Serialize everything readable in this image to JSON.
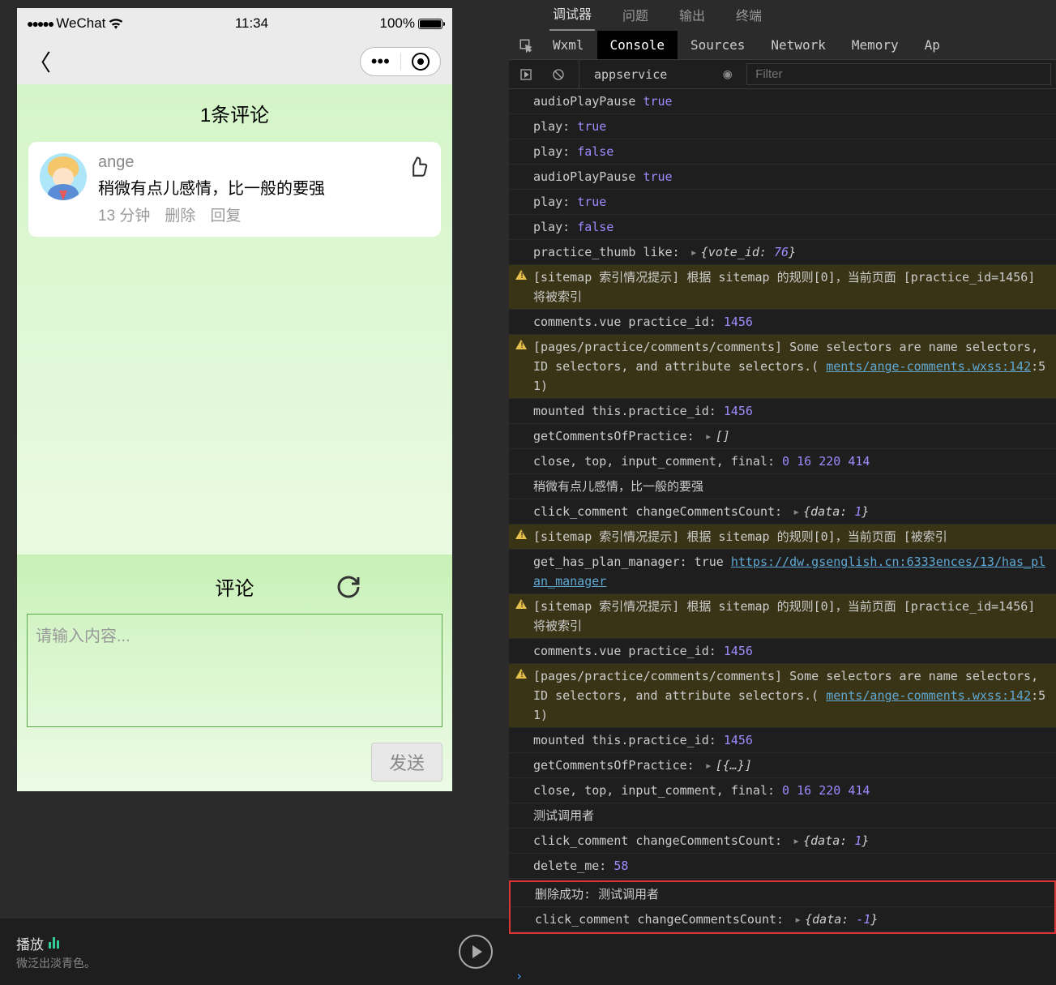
{
  "phone": {
    "statusbar": {
      "carrier": "WeChat",
      "signal_dots": "●●●●●",
      "time": "11:34",
      "battery_pct": "100%"
    },
    "page": {
      "title": "1条评论",
      "comment": {
        "user": "ange",
        "text": "稍微有点儿感情，比一般的要强",
        "time": "13 分钟",
        "delete_label": "删除",
        "reply_label": "回复"
      },
      "footer": {
        "title": "评论",
        "placeholder": "请输入内容...",
        "send_label": "发送"
      }
    }
  },
  "player": {
    "title": "播放",
    "subtitle": "微泛出淡青色。"
  },
  "devtools": {
    "topTabs": [
      "调试器",
      "问题",
      "输出",
      "终端"
    ],
    "topActive": 0,
    "panelTabs": [
      "Wxml",
      "Console",
      "Sources",
      "Network",
      "Memory",
      "Ap"
    ],
    "panelActive": 1,
    "context": "appservice",
    "filterPlaceholder": "Filter",
    "logs": [
      {
        "t": "log",
        "parts": [
          {
            "k": "key",
            "v": "audioPlayPause "
          },
          {
            "k": "bool",
            "v": "true"
          }
        ]
      },
      {
        "t": "log",
        "parts": [
          {
            "k": "key",
            "v": "play: "
          },
          {
            "k": "bool",
            "v": "true"
          }
        ]
      },
      {
        "t": "log",
        "parts": [
          {
            "k": "key",
            "v": "play: "
          },
          {
            "k": "bool",
            "v": "false"
          }
        ]
      },
      {
        "t": "log",
        "parts": [
          {
            "k": "key",
            "v": "audioPlayPause "
          },
          {
            "k": "bool",
            "v": "true"
          }
        ]
      },
      {
        "t": "log",
        "parts": [
          {
            "k": "key",
            "v": "play: "
          },
          {
            "k": "bool",
            "v": "true"
          }
        ]
      },
      {
        "t": "log",
        "parts": [
          {
            "k": "key",
            "v": "play: "
          },
          {
            "k": "bool",
            "v": "false"
          }
        ]
      },
      {
        "t": "log",
        "parts": [
          {
            "k": "key",
            "v": "practice_thumb like:  "
          },
          {
            "k": "caret"
          },
          {
            "k": "obj",
            "v": "{vote_id: 76}"
          }
        ]
      },
      {
        "t": "warn",
        "parts": [
          {
            "k": "txt",
            "v": "[sitemap 索引情况提示] 根据 sitemap 的规则[0]，当前页面 [practice_id=1456] 将被索引"
          }
        ]
      },
      {
        "t": "log",
        "parts": [
          {
            "k": "key",
            "v": "comments.vue practice_id:  "
          },
          {
            "k": "num",
            "v": "1456"
          }
        ]
      },
      {
        "t": "warn",
        "parts": [
          {
            "k": "txt",
            "v": "[pages/practice/comments/comments] Some selectors are name selectors, ID selectors, and attribute selectors.( "
          },
          {
            "k": "link",
            "v": "ments/ange-comments.wxss:142"
          },
          {
            "k": "txt",
            "v": ":51)"
          }
        ]
      },
      {
        "t": "log",
        "parts": [
          {
            "k": "key",
            "v": "mounted this.practice_id:  "
          },
          {
            "k": "num",
            "v": "1456"
          }
        ]
      },
      {
        "t": "log",
        "parts": [
          {
            "k": "key",
            "v": "getCommentsOfPractice:  "
          },
          {
            "k": "caret"
          },
          {
            "k": "obj",
            "v": "[]"
          }
        ]
      },
      {
        "t": "log",
        "parts": [
          {
            "k": "key",
            "v": "close, top, input_comment, final:  "
          },
          {
            "k": "num",
            "v": "0 16 220 414"
          }
        ]
      },
      {
        "t": "log",
        "parts": [
          {
            "k": "key",
            "v": "稍微有点儿感情，比一般的要强"
          }
        ]
      },
      {
        "t": "log",
        "parts": [
          {
            "k": "key",
            "v": "click_comment changeCommentsCount: "
          },
          {
            "k": "caret"
          },
          {
            "k": "obj",
            "v": "{data: 1}"
          }
        ]
      },
      {
        "t": "warn",
        "parts": [
          {
            "k": "txt",
            "v": "[sitemap 索引情况提示] 根据 sitemap 的规则[0]，当前页面 [被索引"
          }
        ]
      },
      {
        "t": "log",
        "parts": [
          {
            "k": "key",
            "v": "get_has_plan_manager: true "
          },
          {
            "k": "link",
            "v": "https://dw.gsenglish.cn:6333ences/13/has_plan_manager"
          }
        ]
      },
      {
        "t": "warn",
        "parts": [
          {
            "k": "txt",
            "v": "[sitemap 索引情况提示] 根据 sitemap 的规则[0]，当前页面 [practice_id=1456] 将被索引"
          }
        ]
      },
      {
        "t": "log",
        "parts": [
          {
            "k": "key",
            "v": "comments.vue practice_id:  "
          },
          {
            "k": "num",
            "v": "1456"
          }
        ]
      },
      {
        "t": "warn",
        "parts": [
          {
            "k": "txt",
            "v": "[pages/practice/comments/comments] Some selectors are name selectors, ID selectors, and attribute selectors.( "
          },
          {
            "k": "link",
            "v": "ments/ange-comments.wxss:142"
          },
          {
            "k": "txt",
            "v": ":51)"
          }
        ]
      },
      {
        "t": "log",
        "parts": [
          {
            "k": "key",
            "v": "mounted this.practice_id:  "
          },
          {
            "k": "num",
            "v": "1456"
          }
        ]
      },
      {
        "t": "log",
        "parts": [
          {
            "k": "key",
            "v": "getCommentsOfPractice:  "
          },
          {
            "k": "caret"
          },
          {
            "k": "obj",
            "v": "[{…}]"
          }
        ]
      },
      {
        "t": "log",
        "parts": [
          {
            "k": "key",
            "v": "close, top, input_comment, final:  "
          },
          {
            "k": "num",
            "v": "0 16 220 414"
          }
        ]
      },
      {
        "t": "log",
        "parts": [
          {
            "k": "key",
            "v": "测试调用者"
          }
        ]
      },
      {
        "t": "log",
        "parts": [
          {
            "k": "key",
            "v": "click_comment changeCommentsCount: "
          },
          {
            "k": "caret"
          },
          {
            "k": "obj",
            "v": "{data: 1}"
          }
        ]
      },
      {
        "t": "log",
        "parts": [
          {
            "k": "key",
            "v": "delete_me:  "
          },
          {
            "k": "num",
            "v": "58"
          }
        ]
      },
      {
        "t": "log",
        "hl": true,
        "parts": [
          {
            "k": "key",
            "v": "删除成功: 测试调用者"
          }
        ]
      },
      {
        "t": "log",
        "hl": true,
        "parts": [
          {
            "k": "key",
            "v": "click_comment changeCommentsCount: "
          },
          {
            "k": "caret"
          },
          {
            "k": "obj",
            "v": "{data: -1}"
          }
        ]
      }
    ]
  }
}
